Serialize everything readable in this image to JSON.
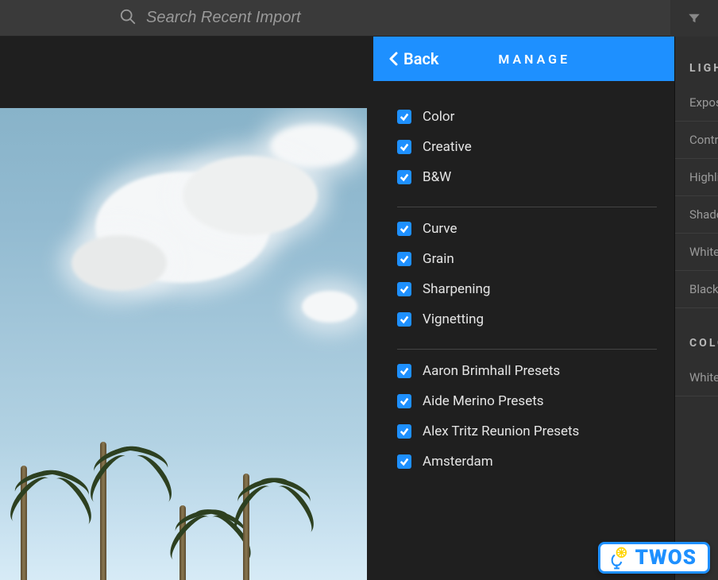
{
  "search": {
    "placeholder": "Search Recent Import"
  },
  "panel": {
    "back_label": "Back",
    "title": "MANAGE"
  },
  "groups": [
    {
      "items": [
        "Color",
        "Creative",
        "B&W"
      ]
    },
    {
      "items": [
        "Curve",
        "Grain",
        "Sharpening",
        "Vignetting"
      ]
    },
    {
      "items": [
        "Aaron Brimhall Presets",
        "Aide Merino Presets",
        "Alex Tritz Reunion Presets",
        "Amsterdam"
      ]
    }
  ],
  "right": {
    "section1": "LIGHT",
    "items1": [
      "Exposure",
      "Contrast",
      "Highlights",
      "Shadows",
      "Whites",
      "Blacks"
    ],
    "section2": "COLOR",
    "items2": [
      "White Balance"
    ]
  },
  "watermark": "TWOS"
}
